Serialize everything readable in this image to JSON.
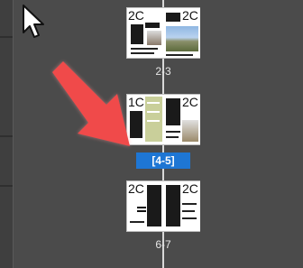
{
  "panel": {
    "background": "#4b4b4b",
    "selected_color": "#1e76d4"
  },
  "spreads": [
    {
      "left_master": "2C",
      "right_master": "2C",
      "label": "2-3",
      "selected": false
    },
    {
      "left_master": "1C",
      "right_master": "2C",
      "label": "[4-5]",
      "selected": true
    },
    {
      "left_master": "2C",
      "right_master": "2C",
      "label": "6-7",
      "selected": false
    }
  ],
  "overlay": {
    "cursor_icon": "mouse-pointer-icon",
    "annotation_icon": "red-arrow-icon",
    "annotation_color": "#f04a4a"
  }
}
